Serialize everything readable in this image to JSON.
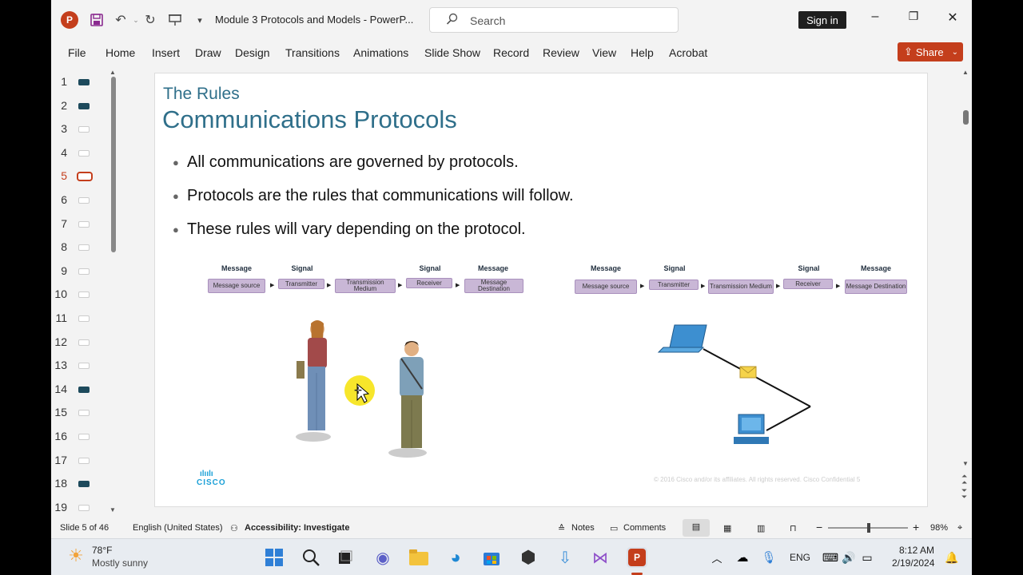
{
  "window": {
    "doc_title": "Module 3 Protocols and Models  -  PowerP...",
    "search_placeholder": "Search",
    "signin_label": "Sign in",
    "app_letter": "P"
  },
  "ribbon": {
    "tabs": [
      "File",
      "Home",
      "Insert",
      "Draw",
      "Design",
      "Transitions",
      "Animations",
      "Slide Show",
      "Record",
      "Review",
      "View",
      "Help",
      "Acrobat"
    ],
    "share_label": "Share"
  },
  "thumbnails": {
    "numbers": [
      "1",
      "2",
      "3",
      "4",
      "5",
      "6",
      "7",
      "8",
      "9",
      "10",
      "11",
      "12",
      "13",
      "14",
      "15",
      "16",
      "17",
      "18",
      "19"
    ],
    "current": "5"
  },
  "slide": {
    "subtitle": "The Rules",
    "title": "Communications Protocols",
    "bullets": [
      "All communications are governed by protocols.",
      "Protocols are the rules that communications will follow.",
      "These rules will vary depending on the protocol."
    ],
    "flow_left": {
      "headers": [
        "Message",
        "Signal",
        "Signal",
        "Message"
      ],
      "boxes": [
        "Message source",
        "Transmitter",
        "Transmission Medium",
        "Receiver",
        "Message Destination"
      ]
    },
    "flow_right": {
      "headers": [
        "Message",
        "Signal",
        "Signal",
        "Message"
      ],
      "boxes": [
        "Message source",
        "Transmitter",
        "Transmission Medium",
        "Receiver",
        "Message Destination"
      ]
    },
    "logo_text": "CISCO",
    "footer": "© 2016  Cisco and/or its affiliates. All rights reserved.   Cisco Confidential          5"
  },
  "status": {
    "slide_info": "Slide 5 of 46",
    "language": "English (United States)",
    "accessibility": "Accessibility: Investigate",
    "notes": "Notes",
    "comments": "Comments",
    "zoom": "98%",
    "zoom_level": 0.49
  },
  "taskbar": {
    "temp": "78°F",
    "weather": "Mostly sunny",
    "lang": "ENG",
    "time": "8:12 AM",
    "date": "2/19/2024"
  },
  "colors": {
    "accent": "#c43e1c",
    "title": "#2f6f8a",
    "flow_box": "#c9b7d6"
  }
}
